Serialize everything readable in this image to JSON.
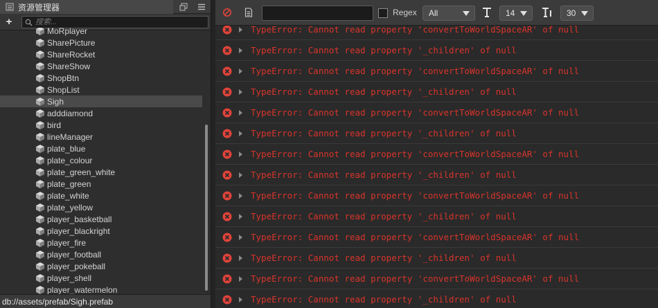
{
  "assets_panel": {
    "title": "资源管理器",
    "search_placeholder": "搜索...",
    "items": [
      "MoRplayer",
      "SharePicture",
      "ShareRocket",
      "ShareShow",
      "ShopBtn",
      "ShopList",
      "Sigh",
      "adddiamond",
      "bird",
      "lineManager",
      "plate_blue",
      "plate_colour",
      "plate_green_white",
      "plate_green",
      "plate_white",
      "plate_yellow",
      "player_basketball",
      "player_blackright",
      "player_fire",
      "player_football",
      "player_pokeball",
      "player_shell",
      "player_watermelon"
    ],
    "selected_item": "Sigh",
    "status_path": "db://assets/prefab/Sigh.prefab"
  },
  "console": {
    "filter_value": "",
    "regex_label": "Regex",
    "level_value": "All",
    "font_size_value": "14",
    "line_count_value": "30",
    "logs": [
      "TypeError: Cannot read property 'convertToWorldSpaceAR' of null",
      "TypeError: Cannot read property '_children' of null",
      "TypeError: Cannot read property 'convertToWorldSpaceAR' of null",
      "TypeError: Cannot read property '_children' of null",
      "TypeError: Cannot read property 'convertToWorldSpaceAR' of null",
      "TypeError: Cannot read property '_children' of null",
      "TypeError: Cannot read property 'convertToWorldSpaceAR' of null",
      "TypeError: Cannot read property '_children' of null",
      "TypeError: Cannot read property 'convertToWorldSpaceAR' of null",
      "TypeError: Cannot read property '_children' of null",
      "TypeError: Cannot read property 'convertToWorldSpaceAR' of null",
      "TypeError: Cannot read property '_children' of null",
      "TypeError: Cannot read property 'convertToWorldSpaceAR' of null",
      "TypeError: Cannot read property '_children' of null"
    ]
  },
  "colors": {
    "error_text": "#d9342b",
    "error_icon": "#e0433a",
    "panel_bg": "#2e2e2e",
    "selected_bg": "#4a4a4a"
  },
  "icons": {
    "header": "folder-icon",
    "maximize": "maximize-icon",
    "menu": "menu-icon",
    "add": "plus-icon",
    "search": "search-icon",
    "asset": "prefab-cube-icon",
    "clear": "clear-console-icon",
    "collapse": "collapse-log-icon",
    "font_size": "font-size-icon",
    "line_count": "line-count-icon",
    "error": "error-icon"
  }
}
